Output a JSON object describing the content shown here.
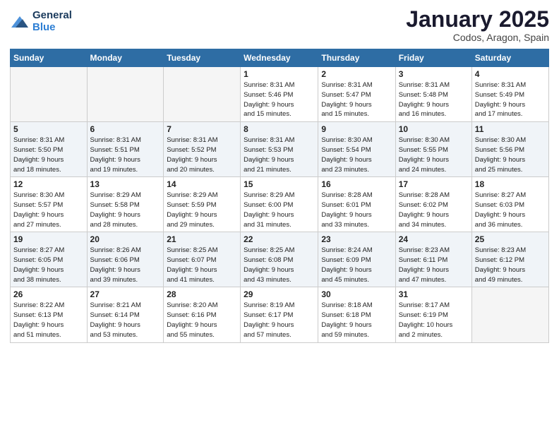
{
  "header": {
    "logo_general": "General",
    "logo_blue": "Blue",
    "month_title": "January 2025",
    "location": "Codos, Aragon, Spain"
  },
  "weekdays": [
    "Sunday",
    "Monday",
    "Tuesday",
    "Wednesday",
    "Thursday",
    "Friday",
    "Saturday"
  ],
  "weeks": [
    [
      {
        "day": "",
        "info": ""
      },
      {
        "day": "",
        "info": ""
      },
      {
        "day": "",
        "info": ""
      },
      {
        "day": "1",
        "info": "Sunrise: 8:31 AM\nSunset: 5:46 PM\nDaylight: 9 hours\nand 15 minutes."
      },
      {
        "day": "2",
        "info": "Sunrise: 8:31 AM\nSunset: 5:47 PM\nDaylight: 9 hours\nand 15 minutes."
      },
      {
        "day": "3",
        "info": "Sunrise: 8:31 AM\nSunset: 5:48 PM\nDaylight: 9 hours\nand 16 minutes."
      },
      {
        "day": "4",
        "info": "Sunrise: 8:31 AM\nSunset: 5:49 PM\nDaylight: 9 hours\nand 17 minutes."
      }
    ],
    [
      {
        "day": "5",
        "info": "Sunrise: 8:31 AM\nSunset: 5:50 PM\nDaylight: 9 hours\nand 18 minutes."
      },
      {
        "day": "6",
        "info": "Sunrise: 8:31 AM\nSunset: 5:51 PM\nDaylight: 9 hours\nand 19 minutes."
      },
      {
        "day": "7",
        "info": "Sunrise: 8:31 AM\nSunset: 5:52 PM\nDaylight: 9 hours\nand 20 minutes."
      },
      {
        "day": "8",
        "info": "Sunrise: 8:31 AM\nSunset: 5:53 PM\nDaylight: 9 hours\nand 21 minutes."
      },
      {
        "day": "9",
        "info": "Sunrise: 8:30 AM\nSunset: 5:54 PM\nDaylight: 9 hours\nand 23 minutes."
      },
      {
        "day": "10",
        "info": "Sunrise: 8:30 AM\nSunset: 5:55 PM\nDaylight: 9 hours\nand 24 minutes."
      },
      {
        "day": "11",
        "info": "Sunrise: 8:30 AM\nSunset: 5:56 PM\nDaylight: 9 hours\nand 25 minutes."
      }
    ],
    [
      {
        "day": "12",
        "info": "Sunrise: 8:30 AM\nSunset: 5:57 PM\nDaylight: 9 hours\nand 27 minutes."
      },
      {
        "day": "13",
        "info": "Sunrise: 8:29 AM\nSunset: 5:58 PM\nDaylight: 9 hours\nand 28 minutes."
      },
      {
        "day": "14",
        "info": "Sunrise: 8:29 AM\nSunset: 5:59 PM\nDaylight: 9 hours\nand 29 minutes."
      },
      {
        "day": "15",
        "info": "Sunrise: 8:29 AM\nSunset: 6:00 PM\nDaylight: 9 hours\nand 31 minutes."
      },
      {
        "day": "16",
        "info": "Sunrise: 8:28 AM\nSunset: 6:01 PM\nDaylight: 9 hours\nand 33 minutes."
      },
      {
        "day": "17",
        "info": "Sunrise: 8:28 AM\nSunset: 6:02 PM\nDaylight: 9 hours\nand 34 minutes."
      },
      {
        "day": "18",
        "info": "Sunrise: 8:27 AM\nSunset: 6:03 PM\nDaylight: 9 hours\nand 36 minutes."
      }
    ],
    [
      {
        "day": "19",
        "info": "Sunrise: 8:27 AM\nSunset: 6:05 PM\nDaylight: 9 hours\nand 38 minutes."
      },
      {
        "day": "20",
        "info": "Sunrise: 8:26 AM\nSunset: 6:06 PM\nDaylight: 9 hours\nand 39 minutes."
      },
      {
        "day": "21",
        "info": "Sunrise: 8:25 AM\nSunset: 6:07 PM\nDaylight: 9 hours\nand 41 minutes."
      },
      {
        "day": "22",
        "info": "Sunrise: 8:25 AM\nSunset: 6:08 PM\nDaylight: 9 hours\nand 43 minutes."
      },
      {
        "day": "23",
        "info": "Sunrise: 8:24 AM\nSunset: 6:09 PM\nDaylight: 9 hours\nand 45 minutes."
      },
      {
        "day": "24",
        "info": "Sunrise: 8:23 AM\nSunset: 6:11 PM\nDaylight: 9 hours\nand 47 minutes."
      },
      {
        "day": "25",
        "info": "Sunrise: 8:23 AM\nSunset: 6:12 PM\nDaylight: 9 hours\nand 49 minutes."
      }
    ],
    [
      {
        "day": "26",
        "info": "Sunrise: 8:22 AM\nSunset: 6:13 PM\nDaylight: 9 hours\nand 51 minutes."
      },
      {
        "day": "27",
        "info": "Sunrise: 8:21 AM\nSunset: 6:14 PM\nDaylight: 9 hours\nand 53 minutes."
      },
      {
        "day": "28",
        "info": "Sunrise: 8:20 AM\nSunset: 6:16 PM\nDaylight: 9 hours\nand 55 minutes."
      },
      {
        "day": "29",
        "info": "Sunrise: 8:19 AM\nSunset: 6:17 PM\nDaylight: 9 hours\nand 57 minutes."
      },
      {
        "day": "30",
        "info": "Sunrise: 8:18 AM\nSunset: 6:18 PM\nDaylight: 9 hours\nand 59 minutes."
      },
      {
        "day": "31",
        "info": "Sunrise: 8:17 AM\nSunset: 6:19 PM\nDaylight: 10 hours\nand 2 minutes."
      },
      {
        "day": "",
        "info": ""
      }
    ]
  ]
}
